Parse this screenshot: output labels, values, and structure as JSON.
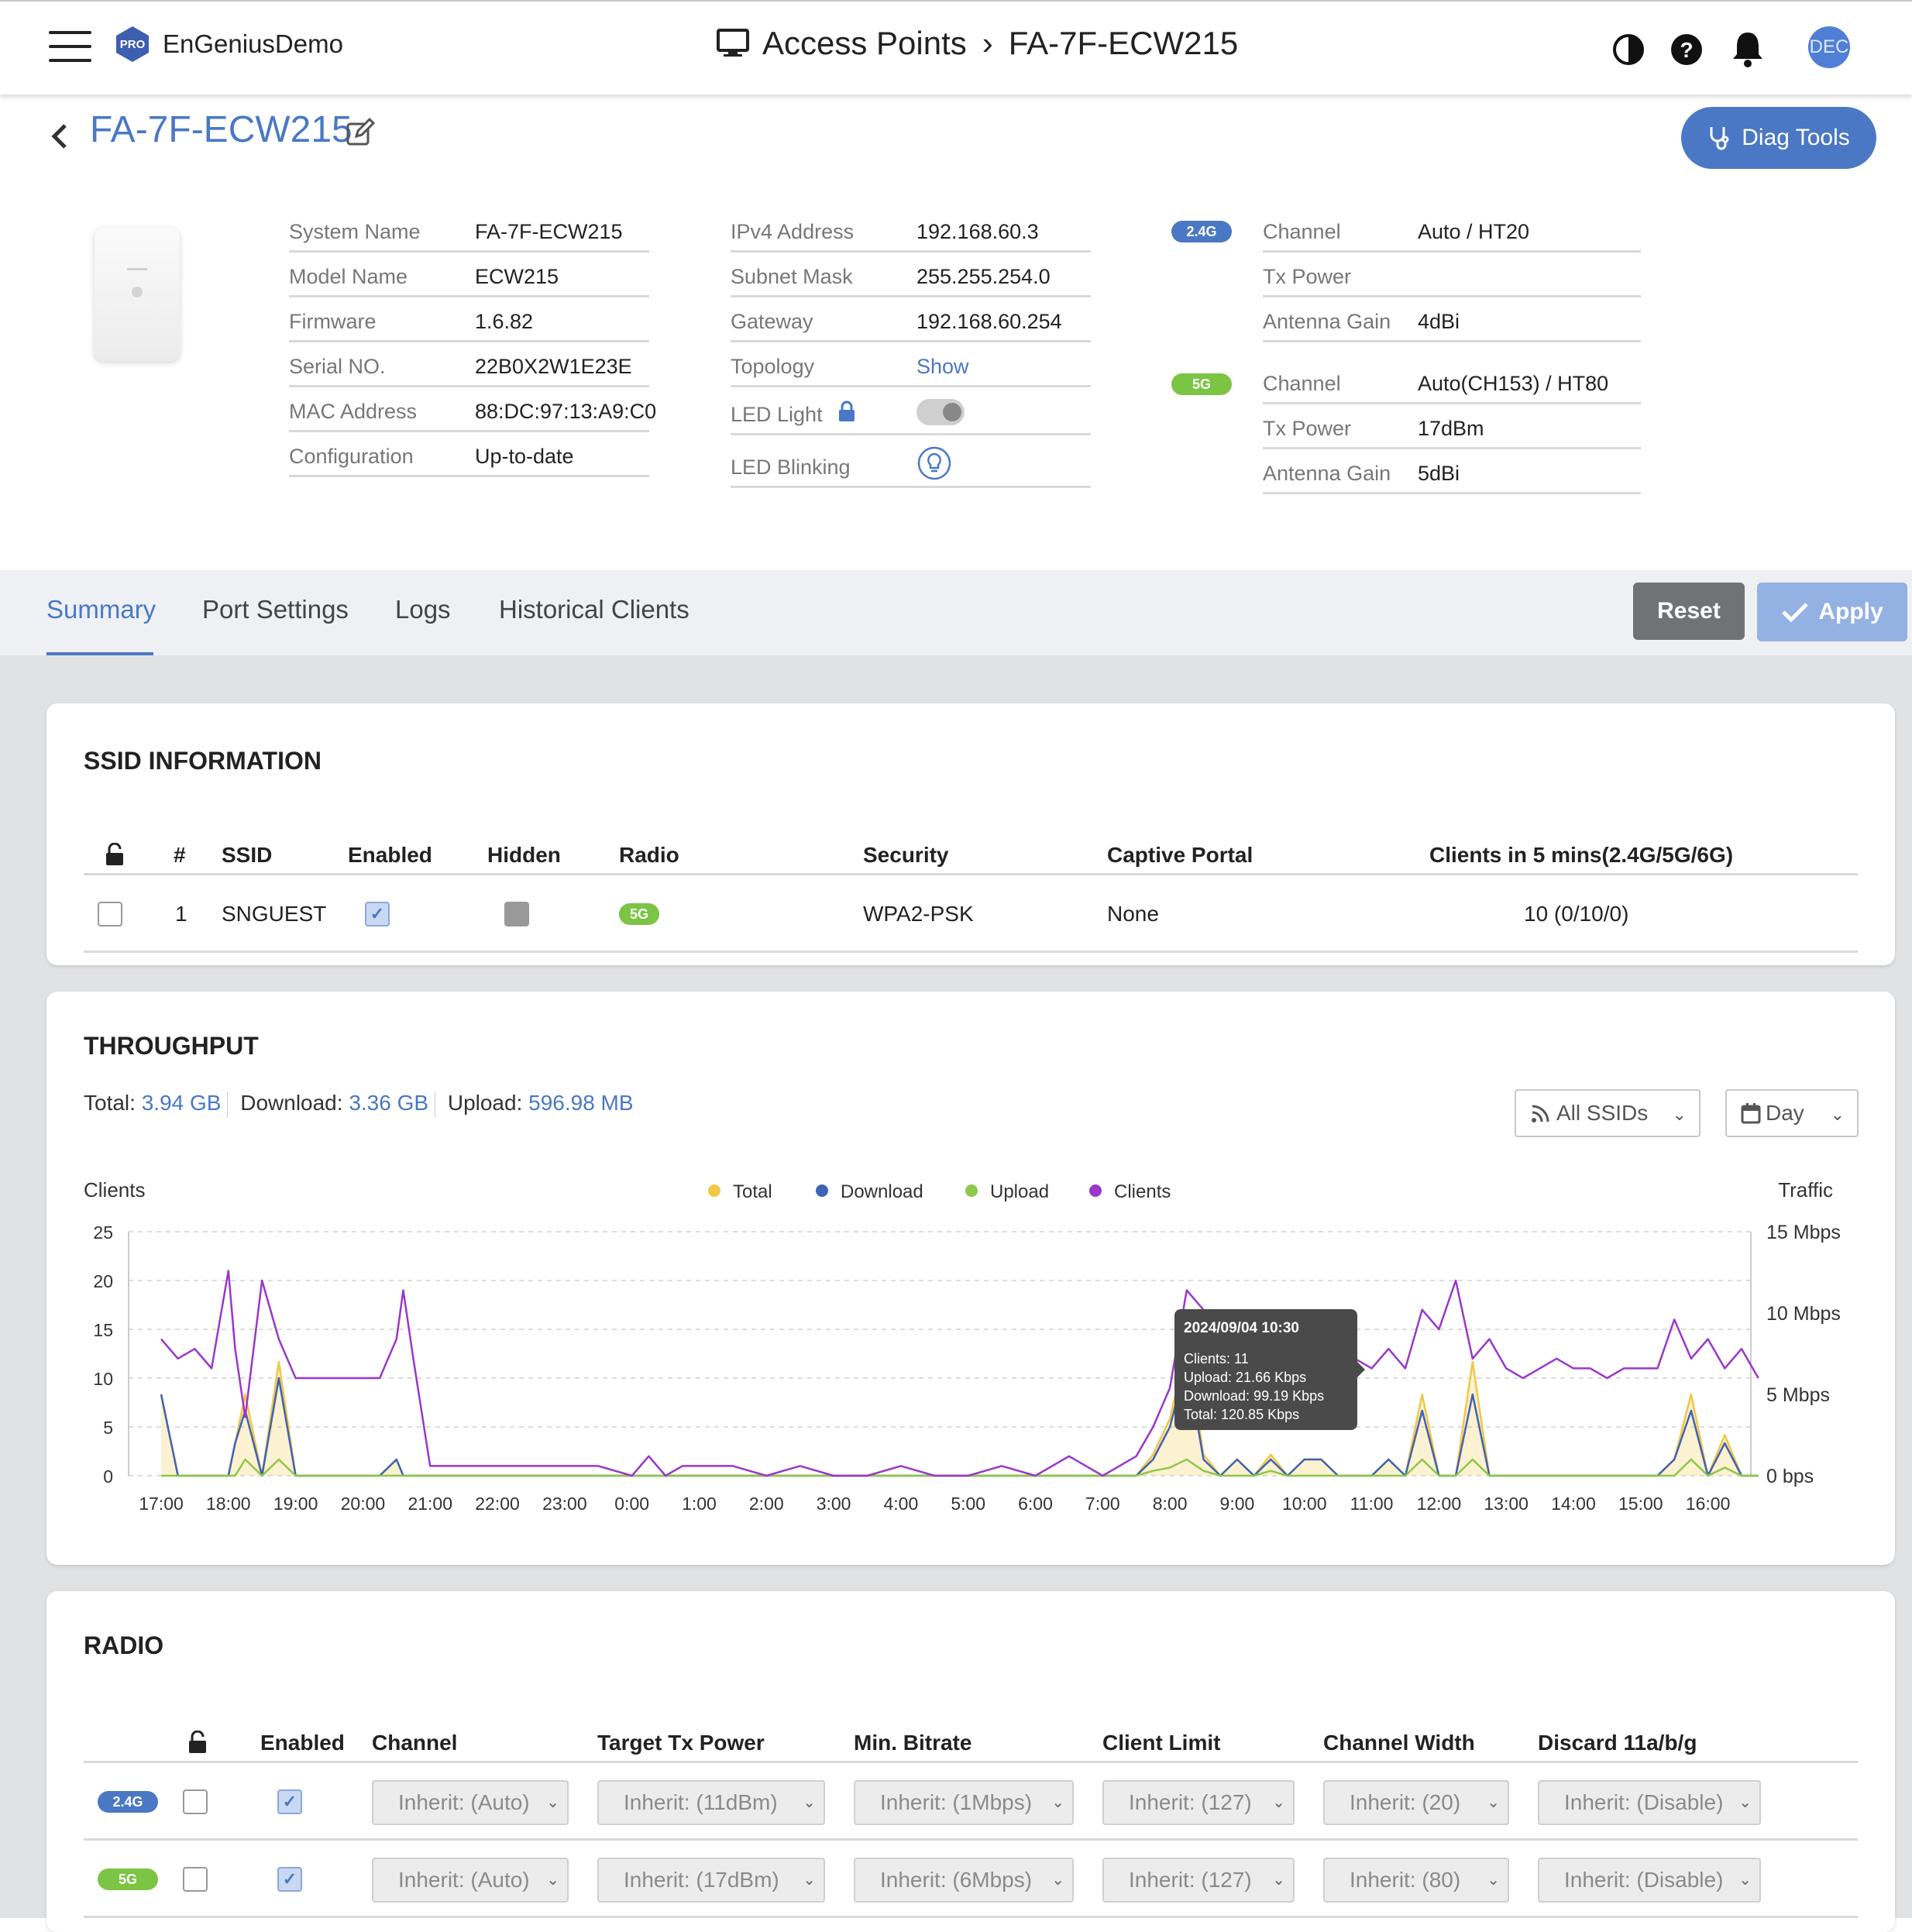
{
  "header": {
    "org_badge": "PRO",
    "org_name": "EnGeniusDemo",
    "title_section": "Access Points",
    "title_separator": "›",
    "title_device": "FA-7F-ECW215",
    "avatar": "DEC",
    "icons": [
      "contrast-icon",
      "help-icon",
      "bell-icon"
    ]
  },
  "device": {
    "name": "FA-7F-ECW215",
    "diag_button": "Diag Tools"
  },
  "info": {
    "system_name_label": "System Name",
    "system_name": "FA-7F-ECW215",
    "model_label": "Model Name",
    "model": "ECW215",
    "firmware_label": "Firmware",
    "firmware": "1.6.82",
    "serial_label": "Serial NO.",
    "serial": "22B0X2W1E23E",
    "mac_label": "MAC Address",
    "mac": "88:DC:97:13:A9:C0",
    "config_label": "Configuration",
    "config": "Up-to-date",
    "ipv4_label": "IPv4 Address",
    "ipv4": "192.168.60.3",
    "subnet_label": "Subnet Mask",
    "subnet": "255.255.254.0",
    "gateway_label": "Gateway",
    "gateway": "192.168.60.254",
    "topology_label": "Topology",
    "topology": "Show",
    "led_light_label": "LED Light",
    "led_blinking_label": "LED Blinking"
  },
  "radio_info": {
    "band24": {
      "badge": "2.4G",
      "channel_label": "Channel",
      "channel": "Auto / HT20",
      "txpower_label": "Tx Power",
      "txpower": "",
      "antenna_label": "Antenna Gain",
      "antenna": "4dBi"
    },
    "band5": {
      "badge": "5G",
      "channel_label": "Channel",
      "channel": "Auto(CH153) / HT80",
      "txpower_label": "Tx Power",
      "txpower": "17dBm",
      "antenna_label": "Antenna Gain",
      "antenna": "5dBi"
    }
  },
  "tabs": [
    "Summary",
    "Port Settings",
    "Logs",
    "Historical Clients"
  ],
  "actions": {
    "reset": "Reset",
    "apply": "Apply"
  },
  "ssid": {
    "title": "SSID INFORMATION",
    "columns": [
      "#",
      "SSID",
      "Enabled",
      "Hidden",
      "Radio",
      "Security",
      "Captive Portal",
      "Clients in 5 mins(2.4G/5G/6G)"
    ],
    "rows": [
      {
        "num": "1",
        "ssid": "SNGUEST",
        "enabled": true,
        "hidden": false,
        "radio": "5G",
        "security": "WPA2-PSK",
        "captive": "None",
        "clients": "10 (0/10/0)"
      }
    ]
  },
  "throughput": {
    "title": "THROUGHPUT",
    "total_label": "Total:",
    "total": "3.94 GB",
    "download_label": "Download:",
    "download": "3.36 GB",
    "upload_label": "Upload:",
    "upload": "596.98 MB",
    "ssid_filter": "All SSIDs",
    "range_filter": "Day",
    "tooltip": {
      "date": "2024/09/04 10:30",
      "clients": "Clients:  11",
      "upload": "Upload:  21.66 Kbps",
      "download": "Download:  99.19 Kbps",
      "total": "Total:  120.85 Kbps"
    }
  },
  "chart_data": {
    "type": "line",
    "left_axis_label": "Clients",
    "right_axis_label": "Traffic",
    "left_ticks": [
      "25",
      "20",
      "15",
      "10",
      "5",
      "0"
    ],
    "right_ticks": [
      "15 Mbps",
      "10 Mbps",
      "5 Mbps",
      "0 bps"
    ],
    "x_ticks": [
      "17:00",
      "18:00",
      "19:00",
      "20:00",
      "21:00",
      "22:00",
      "23:00",
      "0:00",
      "1:00",
      "2:00",
      "3:00",
      "4:00",
      "5:00",
      "6:00",
      "7:00",
      "8:00",
      "9:00",
      "10:00",
      "11:00",
      "12:00",
      "13:00",
      "14:00",
      "15:00",
      "16:00"
    ],
    "legend": [
      {
        "name": "Total",
        "color": "#f2c744"
      },
      {
        "name": "Download",
        "color": "#3f63b5"
      },
      {
        "name": "Upload",
        "color": "#8cc84b"
      },
      {
        "name": "Clients",
        "color": "#9b37c9"
      }
    ],
    "ylim_clients": [
      0,
      25
    ],
    "ylim_traffic_mbps": [
      0,
      15
    ],
    "x_hours": [
      0,
      0.25,
      0.5,
      0.75,
      1,
      1.1,
      1.25,
      1.5,
      1.75,
      2,
      2.25,
      2.5,
      2.75,
      3,
      3.25,
      3.5,
      3.6,
      3.75,
      4,
      4.5,
      5,
      5.5,
      6,
      6.5,
      7,
      7.25,
      7.5,
      7.75,
      8,
      8.5,
      9,
      9.5,
      10,
      10.5,
      11,
      11.5,
      12,
      12.5,
      13,
      13.5,
      14,
      14.25,
      14.5,
      14.75,
      15,
      15.25,
      15.5,
      15.75,
      16,
      16.25,
      16.5,
      16.75,
      17,
      17.25,
      17.5,
      17.75,
      18,
      18.25,
      18.5,
      18.75,
      19,
      19.25,
      19.5,
      19.75,
      20,
      20.25,
      20.5,
      20.75,
      21,
      21.25,
      21.5,
      21.75,
      22,
      22.25,
      22.5,
      22.75,
      23,
      23.25,
      23.5,
      23.75
    ],
    "clients": [
      14,
      12,
      13,
      11,
      21,
      13,
      6,
      20,
      14,
      10,
      10,
      10,
      10,
      10,
      10,
      14,
      19,
      12,
      1,
      1,
      1,
      1,
      1,
      1,
      0,
      2,
      0,
      1,
      1,
      1,
      0,
      1,
      0,
      0,
      1,
      0,
      0,
      1,
      0,
      2,
      0,
      1,
      2,
      5,
      9,
      19,
      17,
      12,
      12,
      10,
      7,
      14,
      11,
      12,
      11,
      12,
      11,
      13,
      11,
      17,
      15,
      20,
      12,
      14,
      11,
      10,
      11,
      12,
      11,
      11,
      10,
      11,
      11,
      11,
      16,
      12,
      14,
      11,
      13,
      10
    ],
    "download_mbps": [
      5,
      0,
      0,
      0,
      0,
      2,
      4,
      0,
      6,
      0,
      0,
      0,
      0,
      0,
      0,
      1,
      0,
      0,
      0,
      0,
      0,
      0,
      0,
      0,
      0,
      0,
      0,
      0,
      0,
      0,
      0,
      0,
      0,
      0,
      0,
      0,
      0,
      0,
      0,
      0,
      0,
      0,
      0,
      1,
      3,
      7,
      1,
      0,
      1,
      0,
      1,
      0,
      1,
      1,
      0,
      0,
      0,
      1,
      0,
      4,
      0,
      0,
      5,
      0,
      0,
      0,
      0,
      0,
      0,
      0,
      0,
      0,
      0,
      0,
      1,
      4,
      0,
      2,
      0,
      0
    ],
    "upload_mbps": [
      0,
      0,
      0,
      0,
      0,
      0,
      1,
      0,
      1,
      0,
      0,
      0,
      0,
      0,
      0,
      0,
      0,
      0,
      0,
      0,
      0,
      0,
      0,
      0,
      0,
      0,
      0,
      0,
      0,
      0,
      0,
      0,
      0,
      0,
      0,
      0,
      0,
      0,
      0,
      0,
      0,
      0,
      0,
      0.3,
      0.5,
      1,
      0.3,
      0,
      0,
      0,
      0.3,
      0,
      0,
      0,
      0,
      0,
      0,
      0,
      0,
      1,
      0,
      0,
      1,
      0,
      0,
      0,
      0,
      0,
      0,
      0,
      0,
      0,
      0,
      0,
      0,
      1,
      0,
      0.5,
      0,
      0
    ],
    "total_mbps": [
      5,
      0,
      0,
      0,
      0,
      2,
      5,
      0,
      7,
      0,
      0,
      0,
      0,
      0,
      0,
      1,
      0,
      0,
      0,
      0,
      0,
      0,
      0,
      0,
      0,
      0,
      0,
      0,
      0,
      0,
      0,
      0,
      0,
      0,
      0,
      0,
      0,
      0,
      0,
      0,
      0,
      0,
      0,
      1.3,
      3.5,
      8,
      1.3,
      0,
      1,
      0,
      1.3,
      0,
      1,
      1,
      0,
      0,
      0,
      1,
      0,
      5,
      0,
      0,
      7,
      0,
      0,
      0,
      0,
      0,
      0,
      0,
      0,
      0,
      0,
      0,
      1,
      5,
      0,
      2.5,
      0,
      0
    ]
  },
  "radio": {
    "title": "RADIO",
    "columns": [
      "Enabled",
      "Channel",
      "Target Tx Power",
      "Min. Bitrate",
      "Client Limit",
      "Channel Width",
      "Discard 11a/b/g"
    ],
    "rows": [
      {
        "band": "2.4G",
        "enabled": true,
        "channel": "Inherit: (Auto)",
        "txpower": "Inherit: (11dBm)",
        "bitrate": "Inherit: (1Mbps)",
        "limit": "Inherit: (127)",
        "width": "Inherit: (20)",
        "discard": "Inherit: (Disable)"
      },
      {
        "band": "5G",
        "enabled": true,
        "channel": "Inherit: (Auto)",
        "txpower": "Inherit: (17dBm)",
        "bitrate": "Inherit: (6Mbps)",
        "limit": "Inherit: (127)",
        "width": "Inherit: (80)",
        "discard": "Inherit: (Disable)"
      }
    ]
  }
}
